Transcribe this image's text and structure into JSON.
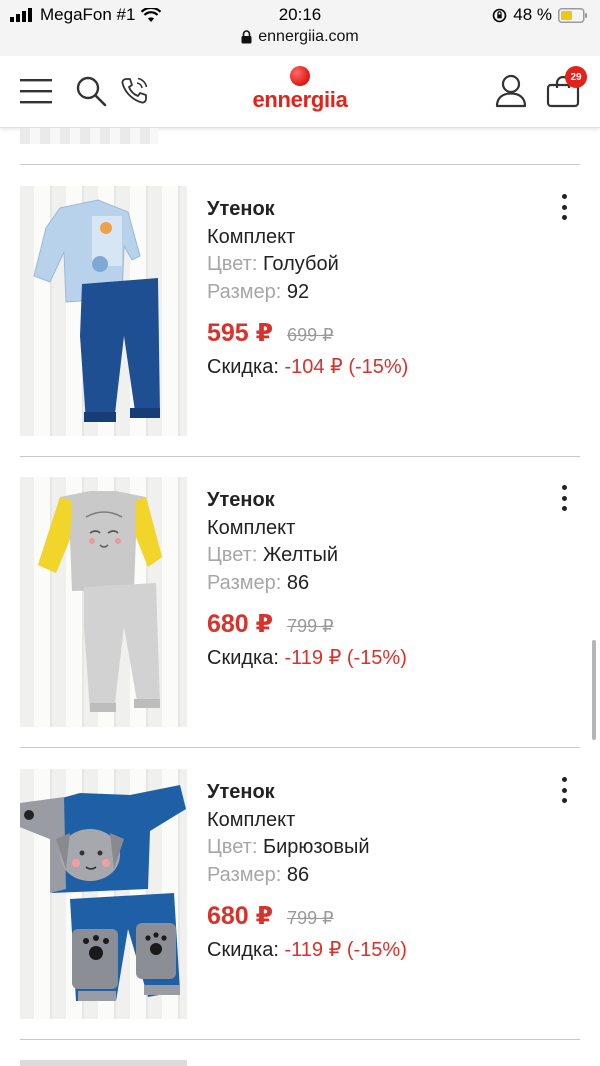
{
  "status": {
    "carrier": "MegaFon #1",
    "time": "20:16",
    "battery": "48 %",
    "url": "ennergiia.com"
  },
  "header": {
    "logo_text": "ennergiia",
    "cart_count": "29",
    "brand_color": "#e2231a"
  },
  "products": [
    {
      "name": "Утенок",
      "type": "Комплект",
      "color_label": "Цвет:",
      "color_value": "Голубой",
      "size_label": "Размер:",
      "size_value": "92",
      "price": "595 ₽",
      "old_price": "699 ₽",
      "discount_label": "Скидка:",
      "discount_value": "-104 ₽ (-15%)"
    },
    {
      "name": "Утенок",
      "type": "Комплект",
      "color_label": "Цвет:",
      "color_value": "Желтый",
      "size_label": "Размер:",
      "size_value": "86",
      "price": "680 ₽",
      "old_price": "799 ₽",
      "discount_label": "Скидка:",
      "discount_value": "-119 ₽ (-15%)"
    },
    {
      "name": "Утенок",
      "type": "Комплект",
      "color_label": "Цвет:",
      "color_value": "Бирюзовый",
      "size_label": "Размер:",
      "size_value": "86",
      "price": "680 ₽",
      "old_price": "799 ₽",
      "discount_label": "Скидка:",
      "discount_value": "-119 ₽ (-15%)"
    }
  ],
  "icons": {
    "menu": "hamburger-menu-icon",
    "search": "search-icon",
    "phone": "phone-icon",
    "account": "user-icon",
    "cart": "shopping-bag-icon",
    "more": "more-vertical-icon"
  }
}
